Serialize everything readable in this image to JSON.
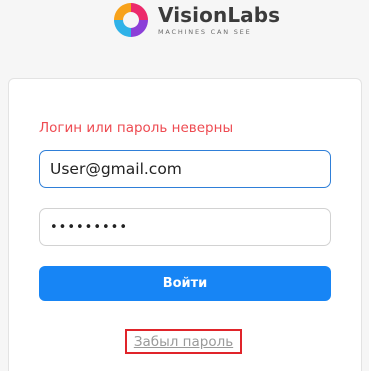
{
  "brand": {
    "name": "VisionLabs",
    "tagline": "MACHINES CAN SEE",
    "logo_colors": [
      "#f7a21b",
      "#ec2a6b",
      "#8b3fd8",
      "#2fb2e8"
    ]
  },
  "login_form": {
    "error_message": "Логин или пароль неверны",
    "email_value": "User@gmail.com",
    "password_value": "•••••••••",
    "submit_label": "Войти",
    "forgot_password_label": "Забыл пароль"
  },
  "colors": {
    "error": "#ee4b52",
    "primary": "#1785f5",
    "focus_border": "#2f7fd8",
    "highlight_box": "#e0242a"
  }
}
